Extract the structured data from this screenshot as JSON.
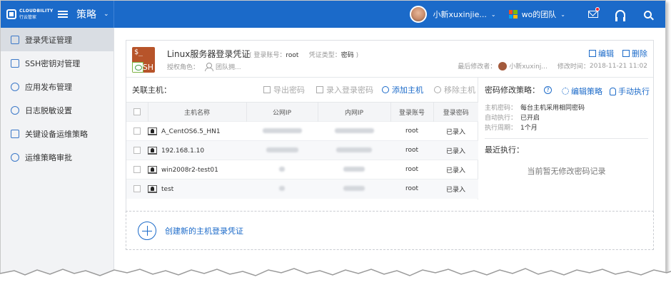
{
  "app": {
    "logo_en": "CLOUDBILITY",
    "logo_cn": "行云管家",
    "section": "策略",
    "user_name": "小新xuxinjie...",
    "team_name": "wo的团队"
  },
  "sidebar": {
    "items": [
      {
        "label": "登录凭证管理",
        "icon": "credential-icon"
      },
      {
        "label": "SSH密钥对管理",
        "icon": "key-icon"
      },
      {
        "label": "应用发布管理",
        "icon": "cloud-icon"
      },
      {
        "label": "日志脱敏设置",
        "icon": "eye-icon"
      },
      {
        "label": "关键设备运维策略",
        "icon": "device-icon"
      },
      {
        "label": "运维策略审批",
        "icon": "shield-icon"
      }
    ]
  },
  "credential": {
    "title": "Linux服务器登录凭证",
    "account_label": "登录账号：",
    "account_value": "root",
    "type_label": "凭证类型：",
    "type_value": "密码",
    "role_label": "授权角色：",
    "role_value": "团队拥...",
    "edit_label": "编辑",
    "delete_label": "删除",
    "modifier_label": "最后修改者：",
    "modifier_name": "小新xuxinj...",
    "modified_label": "修改时间：",
    "modified_time": "2018-11-21 11:02",
    "icon_text": "$_",
    "icon_tag": "SH"
  },
  "hosts": {
    "label": "关联主机：",
    "toolbar": {
      "export": "导出密码",
      "enter": "录入登录密码",
      "add": "添加主机",
      "remove": "移除主机"
    },
    "columns": [
      "主机名称",
      "公网IP",
      "内网IP",
      "登录账号",
      "登录密码"
    ],
    "rows": [
      {
        "name": "A_CentOS6.5_HN1",
        "public_ip_visible": true,
        "private_ip_visible": true,
        "account": "root",
        "password": "已录入"
      },
      {
        "name": "192.168.1.10",
        "public_ip_visible": true,
        "private_ip_visible": true,
        "account": "root",
        "password": "已录入"
      },
      {
        "name": "win2008r2-test01",
        "public_ip_visible": false,
        "private_ip_visible": true,
        "account": "root",
        "password": "已录入"
      },
      {
        "name": "test",
        "public_ip_visible": false,
        "private_ip_visible": true,
        "account": "root",
        "password": "已录入"
      }
    ]
  },
  "policy": {
    "title": "密码修改策略：",
    "help": "?",
    "edit_label": "编辑策略",
    "run_label": "手动执行",
    "items": [
      {
        "key": "主机密码：",
        "value": "每台主机采用相同密码"
      },
      {
        "key": "自动执行：",
        "value": "已开启"
      },
      {
        "key": "执行周期：",
        "value": "1个月"
      }
    ],
    "recent_label": "最近执行：",
    "empty_text": "当前暂无修改密码记录"
  },
  "create": {
    "label": "创建新的主机登录凭证"
  },
  "colors": {
    "accent": "#1b6ac9",
    "sidebar_bg": "#f2f3f5",
    "credential_icon": "#b7542a",
    "notification": "#f5222d"
  }
}
